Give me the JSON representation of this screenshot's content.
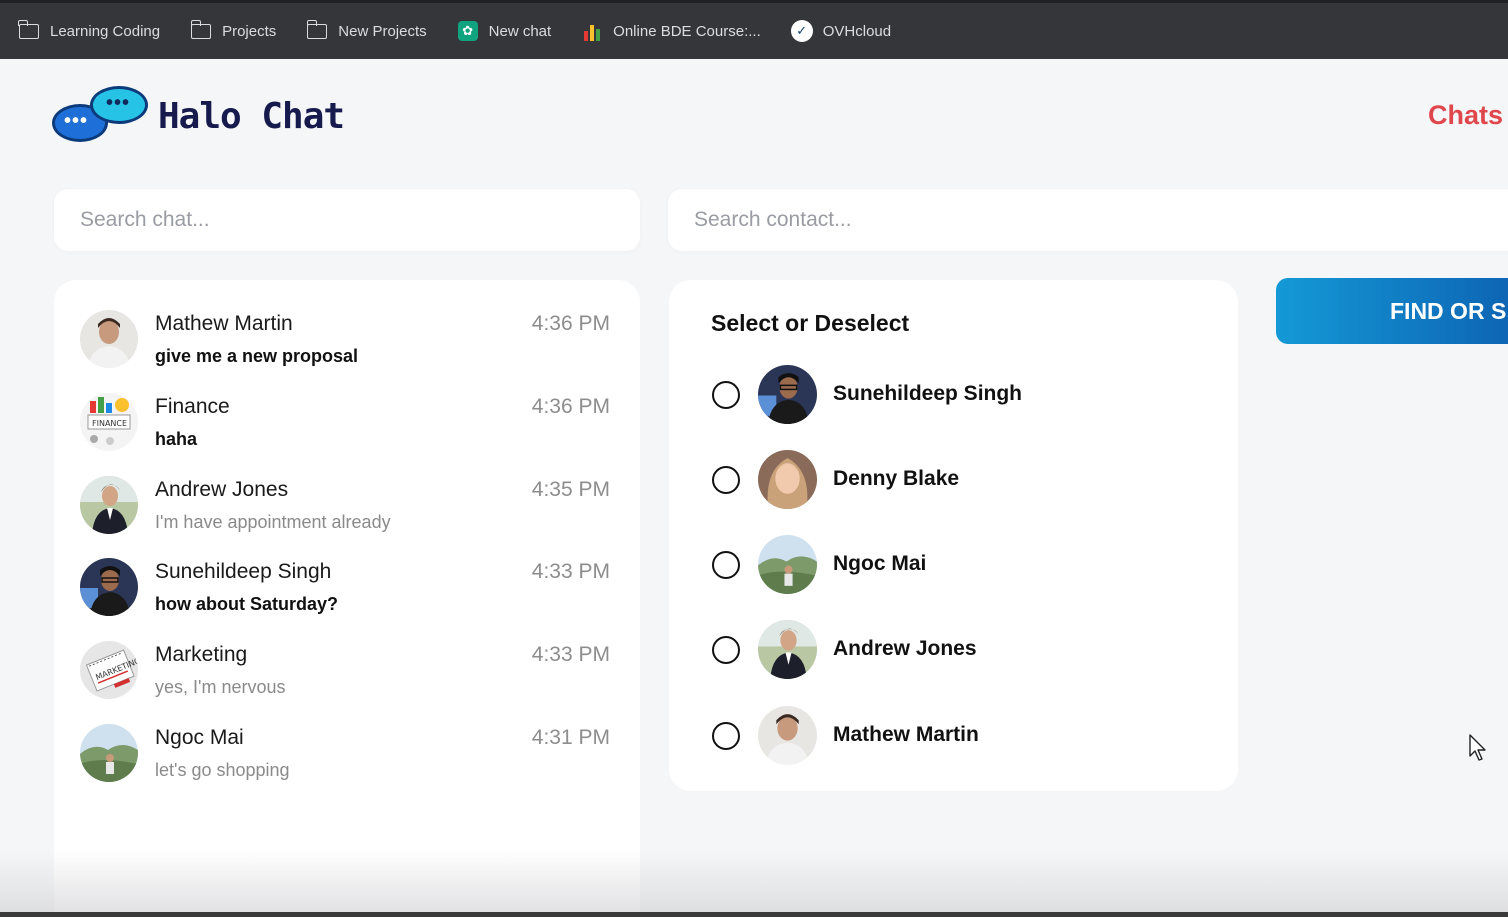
{
  "bookmarks": [
    {
      "label": "Learning Coding",
      "icon": "folder-icon"
    },
    {
      "label": "Projects",
      "icon": "folder-icon"
    },
    {
      "label": "New Projects",
      "icon": "folder-icon"
    },
    {
      "label": "New chat",
      "icon": "chatgpt-icon"
    },
    {
      "label": "Online BDE Course:...",
      "icon": "bde-course-icon"
    },
    {
      "label": "OVHcloud",
      "icon": "ovhcloud-icon"
    }
  ],
  "app": {
    "title": "Halo Chat",
    "nav_chats": "Chats"
  },
  "search": {
    "chat_placeholder": "Search chat...",
    "contact_placeholder": "Search contact..."
  },
  "chats": [
    {
      "name": "Mathew Martin",
      "message": "give me a new proposal",
      "time": "4:36 PM",
      "unread": true
    },
    {
      "name": "Finance",
      "message": "haha",
      "time": "4:36 PM",
      "unread": true
    },
    {
      "name": "Andrew Jones",
      "message": "I'm have appointment already",
      "time": "4:35 PM",
      "unread": false
    },
    {
      "name": "Sunehildeep Singh",
      "message": "how about Saturday?",
      "time": "4:33 PM",
      "unread": true
    },
    {
      "name": "Marketing",
      "message": "yes, I'm nervous",
      "time": "4:33 PM",
      "unread": false
    },
    {
      "name": "Ngoc Mai",
      "message": "let's go shopping",
      "time": "4:31 PM",
      "unread": false
    }
  ],
  "contacts": {
    "title": "Select or Deselect",
    "items": [
      {
        "name": "Sunehildeep Singh",
        "selected": false
      },
      {
        "name": "Denny Blake",
        "selected": false
      },
      {
        "name": "Ngoc Mai",
        "selected": false
      },
      {
        "name": "Andrew Jones",
        "selected": false
      },
      {
        "name": "Mathew Martin",
        "selected": false
      }
    ]
  },
  "actions": {
    "find_label": "FIND OR S"
  },
  "colors": {
    "accent_red": "#e0474c",
    "button_blue": "#1499d6",
    "brand_navy": "#161a4d"
  }
}
